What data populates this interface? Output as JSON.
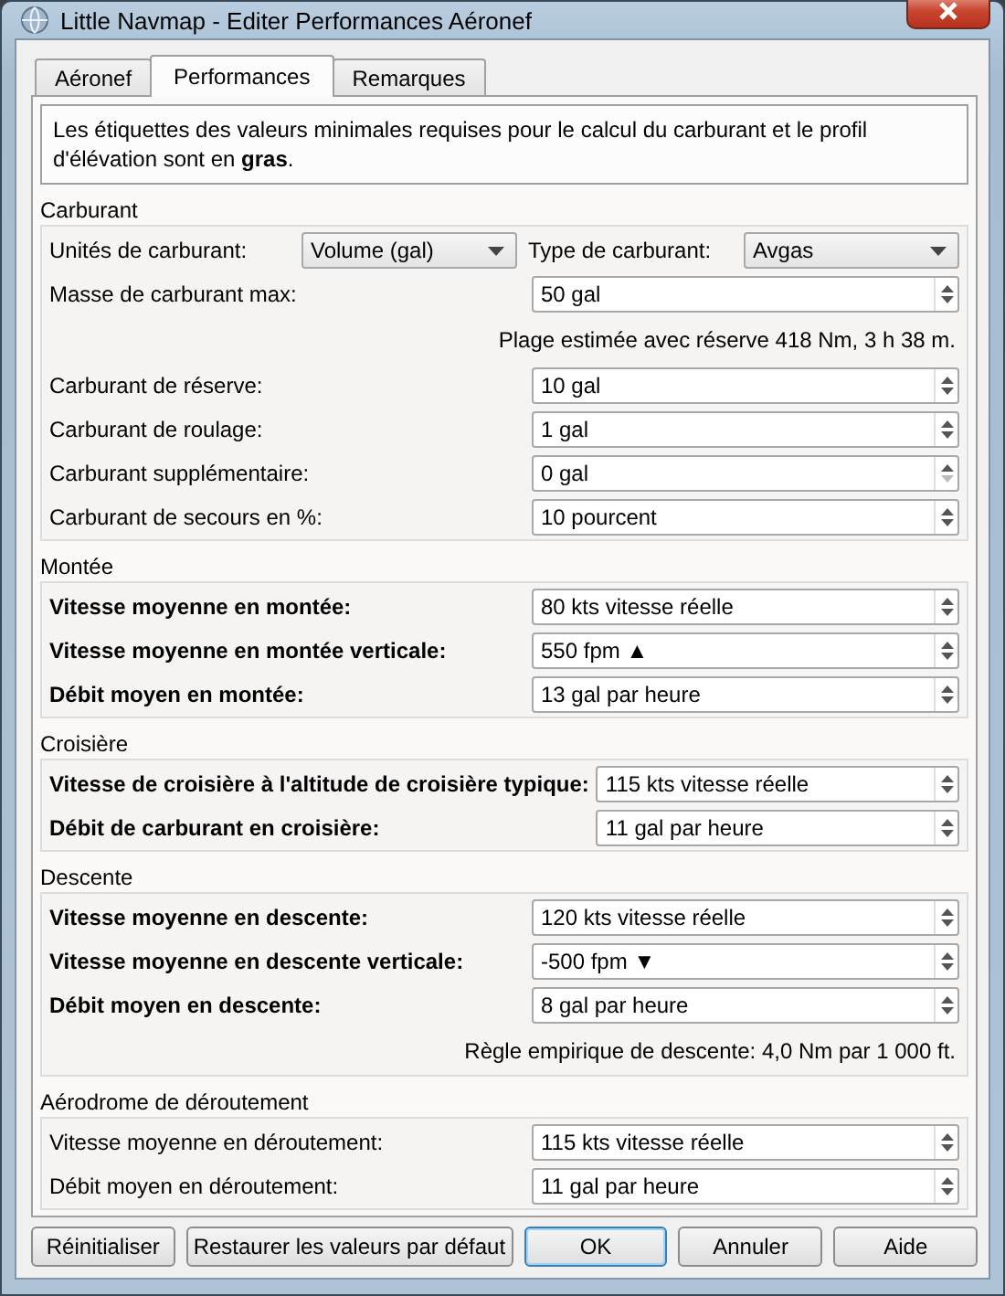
{
  "window": {
    "title": "Little Navmap - Editer Performances Aéronef"
  },
  "tabs": [
    {
      "label": "Aéronef",
      "selected": false
    },
    {
      "label": "Performances",
      "selected": true
    },
    {
      "label": "Remarques",
      "selected": false
    }
  ],
  "info": "Les étiquettes des valeurs minimales requises pour le calcul du carburant et le profil d'élévation sont en **gras**.",
  "sections": [
    {
      "title": "Carburant",
      "rows": [
        {
          "kind": "combos",
          "items": [
            {
              "label": "Unités de carburant:",
              "value": "Volume (gal)"
            },
            {
              "label": "Type de carburant:",
              "value": "Avgas"
            }
          ]
        },
        {
          "kind": "spin",
          "label": "Masse de carburant max:",
          "bold": false,
          "value": "50 gal",
          "down_disabled": false
        },
        {
          "kind": "note",
          "text": "Plage estimée avec réserve 418 Nm, 3 h 38 m."
        },
        {
          "kind": "spin",
          "label": "Carburant de réserve:",
          "bold": false,
          "value": "10 gal",
          "down_disabled": false
        },
        {
          "kind": "spin",
          "label": "Carburant de roulage:",
          "bold": false,
          "value": "1 gal",
          "down_disabled": false
        },
        {
          "kind": "spin",
          "label": "Carburant supplémentaire:",
          "bold": false,
          "value": "0 gal",
          "down_disabled": true
        },
        {
          "kind": "spin",
          "label": "Carburant de secours en %:",
          "bold": false,
          "value": "10 pourcent",
          "down_disabled": false
        }
      ]
    },
    {
      "title": "Montée",
      "rows": [
        {
          "kind": "spin",
          "label": "Vitesse moyenne en montée:",
          "bold": true,
          "value": "80 kts vitesse réelle",
          "down_disabled": false
        },
        {
          "kind": "spin",
          "label": "Vitesse moyenne en montée verticale:",
          "bold": true,
          "value": "550 fpm ▲",
          "down_disabled": false
        },
        {
          "kind": "spin",
          "label": "Débit moyen en montée:",
          "bold": true,
          "value": "13 gal par heure",
          "down_disabled": false
        }
      ]
    },
    {
      "title": "Croisière",
      "rows": [
        {
          "kind": "spin",
          "label": "Vitesse de croisière à l'altitude de croisière typique:",
          "bold": true,
          "value": "115 kts vitesse réelle",
          "down_disabled": false
        },
        {
          "kind": "spin",
          "label": "Débit de carburant en croisière:",
          "bold": true,
          "value": "11 gal par heure",
          "down_disabled": false
        }
      ]
    },
    {
      "title": "Descente",
      "rows": [
        {
          "kind": "spin",
          "label": "Vitesse moyenne en descente:",
          "bold": true,
          "value": "120 kts vitesse réelle",
          "down_disabled": false
        },
        {
          "kind": "spin",
          "label": "Vitesse moyenne en descente verticale:",
          "bold": true,
          "value": "-500 fpm ▼",
          "down_disabled": false
        },
        {
          "kind": "spin",
          "label": "Débit moyen en descente:",
          "bold": true,
          "value": "8 gal par heure",
          "down_disabled": false
        },
        {
          "kind": "note",
          "text": "Règle empirique de descente: 4,0 Nm par 1 000 ft."
        }
      ]
    },
    {
      "title": "Aérodrome de déroutement",
      "rows": [
        {
          "kind": "spin",
          "label": "Vitesse moyenne en déroutement:",
          "bold": false,
          "value": "115 kts vitesse réelle",
          "down_disabled": false
        },
        {
          "kind": "spin",
          "label": "Débit moyen en déroutement:",
          "bold": false,
          "value": "11 gal par heure",
          "down_disabled": false
        }
      ]
    }
  ],
  "buttons": [
    {
      "label": "Réinitialiser",
      "default": false
    },
    {
      "label": "Restaurer les valeurs par défaut",
      "default": false
    },
    {
      "label": "OK",
      "default": true
    },
    {
      "label": "Annuler",
      "default": false
    },
    {
      "label": "Aide",
      "default": false
    }
  ]
}
